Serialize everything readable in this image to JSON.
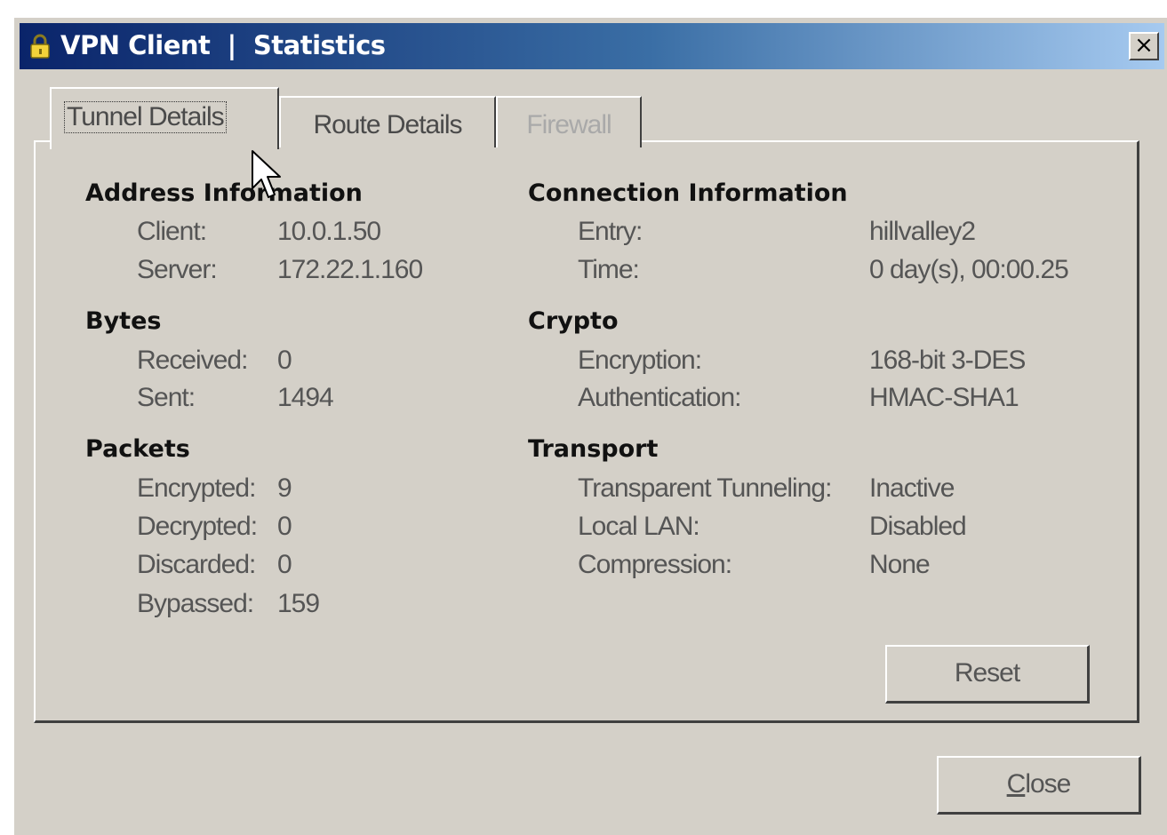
{
  "window": {
    "title": "VPN Client  |  Statistics",
    "close_glyph": "×",
    "title_icon": "lock-icon"
  },
  "tabs": [
    {
      "label": "Tunnel Details",
      "state": "active"
    },
    {
      "label": "Route Details",
      "state": "normal"
    },
    {
      "label": "Firewall",
      "state": "disabled"
    }
  ],
  "address": {
    "title": "Address Information",
    "client_label": "Client:",
    "client_value": "10.0.1.50",
    "server_label": "Server:",
    "server_value": "172.22.1.160"
  },
  "connection": {
    "title": "Connection Information",
    "entry_label": "Entry:",
    "entry_value": "hillvalley2",
    "time_label": "Time:",
    "time_value": "0 day(s), 00:00.25"
  },
  "bytes": {
    "title": "Bytes",
    "received_label": "Received:",
    "received_value": "0",
    "sent_label": "Sent:",
    "sent_value": "1494"
  },
  "crypto": {
    "title": "Crypto",
    "encryption_label": "Encryption:",
    "encryption_value": "168-bit 3-DES",
    "auth_label": "Authentication:",
    "auth_value": "HMAC-SHA1"
  },
  "packets": {
    "title": "Packets",
    "encrypted_label": "Encrypted:",
    "encrypted_value": "9",
    "decrypted_label": "Decrypted:",
    "decrypted_value": "0",
    "discarded_label": "Discarded:",
    "discarded_value": "0",
    "bypassed_label": "Bypassed:",
    "bypassed_value": "159"
  },
  "transport": {
    "title": "Transport",
    "tunneling_label": "Transparent Tunneling:",
    "tunneling_value": "Inactive",
    "lan_label": "Local LAN:",
    "lan_value": "Disabled",
    "compression_label": "Compression:",
    "compression_value": "None"
  },
  "buttons": {
    "reset_label": "Reset",
    "close_mnemonic": "C",
    "close_rest": "lose"
  },
  "colors": {
    "title_gradient_start": "#0a246a",
    "title_gradient_end": "#a6caf0",
    "face": "#d4d0c8"
  }
}
